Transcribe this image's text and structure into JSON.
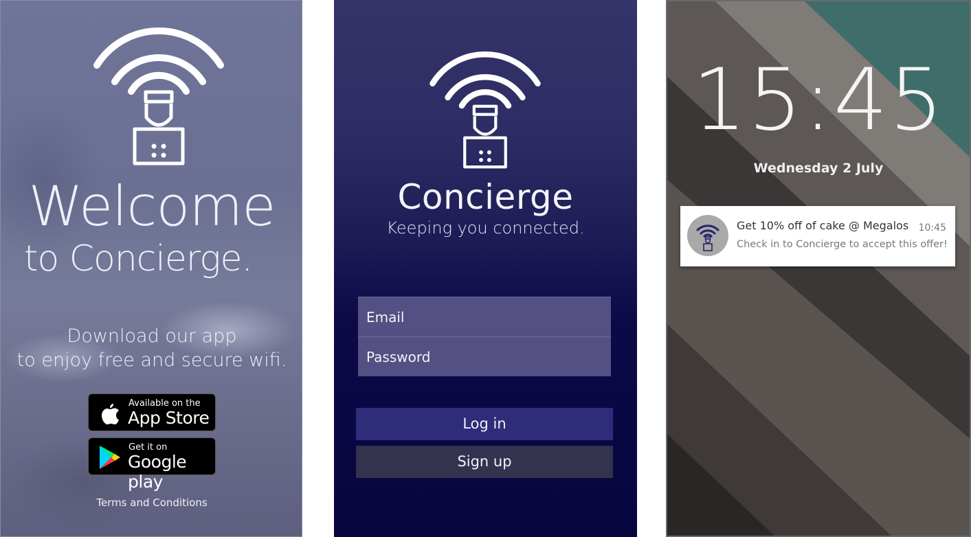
{
  "welcome": {
    "title": "Welcome",
    "subtitle": "to Concierge.",
    "download_line1": "Download our app",
    "download_line2": "to enjoy free and secure wifi.",
    "app_store": {
      "small": "Available on the",
      "big": "App Store"
    },
    "google_play": {
      "small": "Get it on",
      "big": "Google play"
    },
    "terms": "Terms and Conditions"
  },
  "login": {
    "app_name": "Concierge",
    "tagline": "Keeping you connected.",
    "email_placeholder": "Email",
    "password_placeholder": "Password",
    "login_label": "Log in",
    "signup_label": "Sign up"
  },
  "lockscreen": {
    "time": "15:45",
    "date": "Wednesday 2 July",
    "notification": {
      "title": "Get 10% off of cake @ Megalos",
      "time": "10:45",
      "body": "Check in to Concierge to accept this offer!"
    }
  },
  "colors": {
    "welcome_bg": "#6f7498",
    "login_bg_top": "#34346a",
    "login_bg_bottom": "#08063f",
    "field_bg": "#545083",
    "login_button": "#2f2c7a",
    "signup_button": "#33324f",
    "lock_teal": "#3f6e6a"
  }
}
